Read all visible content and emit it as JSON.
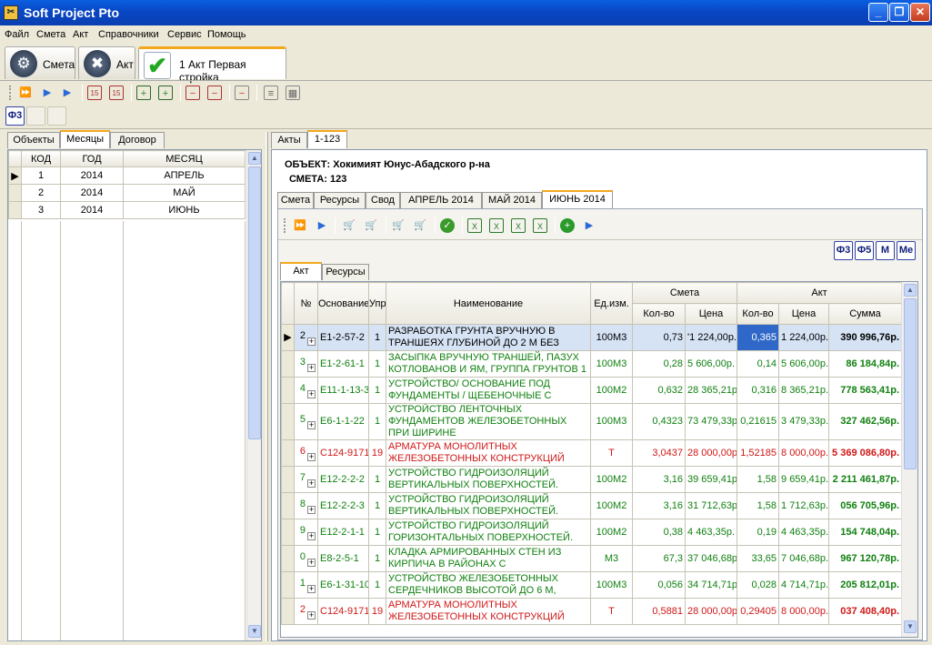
{
  "app": {
    "title": "Soft Project Pto"
  },
  "menu": [
    "Файл",
    "Смета",
    "Акт",
    "Справочники",
    "Сервис",
    "Помощь"
  ],
  "doc_tabs": [
    {
      "label": "Смета"
    },
    {
      "label": "Акт"
    },
    {
      "label": "1 Акт Первая стройка"
    }
  ],
  "phi_button": "Ф3",
  "left_tabs": [
    "Объекты",
    "Месяцы",
    "Договор"
  ],
  "months_table": {
    "headers": [
      "КОД",
      "ГОД",
      "МЕСЯЦ"
    ],
    "rows": [
      [
        "1",
        "2014",
        "АПРЕЛЬ"
      ],
      [
        "2",
        "2014",
        "МАЙ"
      ],
      [
        "3",
        "2014",
        "ИЮНЬ"
      ]
    ]
  },
  "right_tabs": [
    "Акты",
    "1-123"
  ],
  "info": {
    "object_label": "ОБЪЕКТ:",
    "object_value": "Хокимият Юнус-Абадского р-на",
    "smeta_label": "СМЕТА:",
    "smeta_value": "123"
  },
  "inner_tabs": [
    "Смета",
    "Ресурсы",
    "Свод",
    "АПРЕЛЬ 2014",
    "МАЙ 2014",
    "ИЮНЬ 2014"
  ],
  "form_buttons": [
    "Ф3",
    "Ф5",
    "М",
    "Ме"
  ],
  "grid_tabs": [
    "Акт",
    "Ресурсы"
  ],
  "grid_headers": {
    "num": "№",
    "osnov": "Основание",
    "upr": "Упр",
    "name": "Наименование",
    "unit": "Ед.изм.",
    "smeta": "Смета",
    "akt": "Акт",
    "qty": "Кол-во",
    "price": "Цена",
    "sum": "Сумма"
  },
  "grid_rows": [
    {
      "n": "2",
      "code": "Е1-2-57-2",
      "u": "1",
      "name": "РАЗРАБОТКА ГРУНТА ВРУЧНУЮ В ТРАНШЕЯХ ГЛУБИНОЙ ДО 2 М БЕЗ",
      "unit": "100М3",
      "sq": "0,73",
      "sp": "'1 224,00р.",
      "aq": "0,365",
      "ap": "1 224,00р.",
      "sum": "390 996,76р."
    },
    {
      "n": "3",
      "code": "Е1-2-61-1",
      "u": "1",
      "name": "ЗАСЫПКА ВРУЧНУЮ ТРАНШЕЙ, ПАЗУХ КОТЛОВАНОВ И ЯМ, ГРУППА ГРУНТОВ 1",
      "unit": "100М3",
      "sq": "0,28",
      "sp": "5 606,00р.",
      "aq": "0,14",
      "ap": "5 606,00р.",
      "sum": "86 184,84р."
    },
    {
      "n": "4",
      "code": "Е11-1-13-3",
      "u": "1",
      "name": "УСТРОЙСТВО/ ОСНОВАНИЕ ПОД ФУНДАМЕНТЫ / ЩЕБЕНОЧНЫЕ С",
      "unit": "100М2",
      "sq": "0,632",
      "sp": "28 365,21р.",
      "aq": "0,316",
      "ap": "8 365,21р.",
      "sum": "778 563,41р."
    },
    {
      "n": "5",
      "code": "Е6-1-1-22",
      "u": "1",
      "name": "УСТРОЙСТВО ЛЕНТОЧНЫХ ФУНДАМЕНТОВ ЖЕЛЕЗОБЕТОННЫХ ПРИ ШИРИНЕ",
      "unit": "100М3",
      "sq": "0,4323",
      "sp": "73 479,33р.",
      "aq": "0,21615",
      "ap": "3 479,33р.",
      "sum": "327 462,56р."
    },
    {
      "n": "6",
      "code": "С124-9171",
      "u": "19",
      "name": "АРМАТУРА МОНОЛИТНЫХ ЖЕЛЕЗОБЕТОННЫХ КОНСТРУКЦИЙ",
      "unit": "Т",
      "sq": "3,0437",
      "sp": "28 000,00р.",
      "aq": "1,52185",
      "ap": "8 000,00р.",
      "sum": "5 369 086,80р."
    },
    {
      "n": "7",
      "code": "Е12-2-2-2",
      "u": "1",
      "name": "УСТРОЙСТВО ГИДРОИЗОЛЯЦИЙ ВЕРТИКАЛЬНЫХ ПОВЕРХНОСТЕЙ.",
      "unit": "100М2",
      "sq": "3,16",
      "sp": "39 659,41р.",
      "aq": "1,58",
      "ap": "9 659,41р.",
      "sum": "2 211 461,87р."
    },
    {
      "n": "8",
      "code": "Е12-2-2-3",
      "u": "1",
      "name": "УСТРОЙСТВО ГИДРОИЗОЛЯЦИЙ ВЕРТИКАЛЬНЫХ ПОВЕРХНОСТЕЙ.",
      "unit": "100М2",
      "sq": "3,16",
      "sp": "31 712,63р.",
      "aq": "1,58",
      "ap": "1 712,63р.",
      "sum": "056 705,96р."
    },
    {
      "n": "9",
      "code": "Е12-2-1-1",
      "u": "1",
      "name": "УСТРОЙСТВО ГИДРОИЗОЛЯЦИЙ ГОРИЗОНТАЛЬНЫХ ПОВЕРХНОСТЕЙ.",
      "unit": "100М2",
      "sq": "0,38",
      "sp": "4 463,35р.",
      "aq": "0,19",
      "ap": "4 463,35р.",
      "sum": "154 748,04р."
    },
    {
      "n": "0",
      "code": "Е8-2-5-1",
      "u": "1",
      "name": "КЛАДКА АРМИРОВАННЫХ СТЕН ИЗ КИРПИЧА В РАЙОНАХ С",
      "unit": "М3",
      "sq": "67,3",
      "sp": "37 046,68р.",
      "aq": "33,65",
      "ap": "7 046,68р.",
      "sum": "967 120,78р."
    },
    {
      "n": "1",
      "code": "Е6-1-31-10",
      "u": "1",
      "name": "УСТРОЙСТВО ЖЕЛЕЗОБЕТОННЫХ СЕРДЕЧНИКОВ ВЫСОТОЙ ДО 6 М,",
      "unit": "100М3",
      "sq": "0,056",
      "sp": "34 714,71р.",
      "aq": "0,028",
      "ap": "4 714,71р.",
      "sum": "205 812,01р."
    },
    {
      "n": "2",
      "code": "С124-9171",
      "u": "19",
      "name": "АРМАТУРА  МОНОЛИТНЫХ ЖЕЛЕЗОБЕТОННЫХ КОНСТРУКЦИЙ",
      "unit": "Т",
      "sq": "0,5881",
      "sp": "28 000,00р.",
      "aq": "0,29405",
      "ap": "8 000,00р.",
      "sum": "037 408,40р."
    }
  ]
}
